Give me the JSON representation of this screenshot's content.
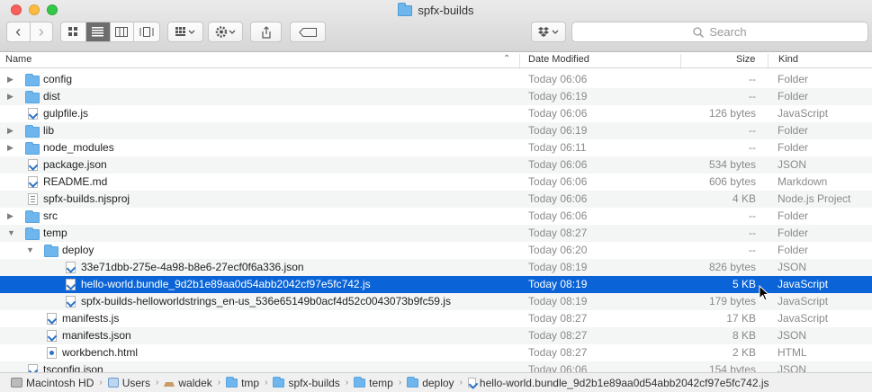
{
  "window": {
    "title": "spfx-builds"
  },
  "toolbar": {
    "back_glyph": "‹",
    "forward_glyph": "›",
    "search_placeholder": "Search",
    "icons": [
      "icon-view-icon",
      "list-view-icon",
      "column-view-icon",
      "gallery-view-icon",
      "group-icon",
      "gear-icon",
      "share-icon",
      "tag-icon",
      "dropbox-icon"
    ]
  },
  "columns": {
    "name": "Name",
    "date": "Date Modified",
    "size": "Size",
    "kind": "Kind",
    "sort_glyph": "⌃"
  },
  "rows": [
    {
      "name": "config",
      "date": "Today 06:06",
      "size": "--",
      "kind": "Folder"
    },
    {
      "name": "dist",
      "date": "Today 06:19",
      "size": "--",
      "kind": "Folder"
    },
    {
      "name": "gulpfile.js",
      "date": "Today 06:06",
      "size": "126 bytes",
      "kind": "JavaScript"
    },
    {
      "name": "lib",
      "date": "Today 06:19",
      "size": "--",
      "kind": "Folder"
    },
    {
      "name": "node_modules",
      "date": "Today 06:11",
      "size": "--",
      "kind": "Folder"
    },
    {
      "name": "package.json",
      "date": "Today 06:06",
      "size": "534 bytes",
      "kind": "JSON"
    },
    {
      "name": "README.md",
      "date": "Today 06:06",
      "size": "606 bytes",
      "kind": "Markdown"
    },
    {
      "name": "spfx-builds.njsproj",
      "date": "Today 06:06",
      "size": "4 KB",
      "kind": "Node.js Project"
    },
    {
      "name": "src",
      "date": "Today 06:06",
      "size": "--",
      "kind": "Folder"
    },
    {
      "name": "temp",
      "date": "Today 08:27",
      "size": "--",
      "kind": "Folder"
    },
    {
      "name": "deploy",
      "date": "Today 06:20",
      "size": "--",
      "kind": "Folder"
    },
    {
      "name": "33e71dbb-275e-4a98-b8e6-27ecf0f6a336.json",
      "date": "Today 08:19",
      "size": "826 bytes",
      "kind": "JSON"
    },
    {
      "name": "hello-world.bundle_9d2b1e89aa0d54abb2042cf97e5fc742.js",
      "date": "Today 08:19",
      "size": "5 KB",
      "kind": "JavaScript"
    },
    {
      "name": "spfx-builds-helloworldstrings_en-us_536e65149b0acf4d52c0043073b9fc59.js",
      "date": "Today 08:19",
      "size": "179 bytes",
      "kind": "JavaScript"
    },
    {
      "name": "manifests.js",
      "date": "Today 08:27",
      "size": "17 KB",
      "kind": "JavaScript"
    },
    {
      "name": "manifests.json",
      "date": "Today 08:27",
      "size": "8 KB",
      "kind": "JSON"
    },
    {
      "name": "workbench.html",
      "date": "Today 08:27",
      "size": "2 KB",
      "kind": "HTML"
    },
    {
      "name": "tsconfig.json",
      "date": "Today 06:06",
      "size": "154 bytes",
      "kind": "JSON"
    }
  ],
  "row_meta": [
    {
      "indent": 0,
      "type": "folder",
      "expander": "▶"
    },
    {
      "indent": 0,
      "type": "folder",
      "expander": "▶"
    },
    {
      "indent": 0,
      "type": "js",
      "expander": ""
    },
    {
      "indent": 0,
      "type": "folder",
      "expander": "▶"
    },
    {
      "indent": 0,
      "type": "folder",
      "expander": "▶"
    },
    {
      "indent": 0,
      "type": "js",
      "expander": ""
    },
    {
      "indent": 0,
      "type": "js",
      "expander": ""
    },
    {
      "indent": 0,
      "type": "proj",
      "expander": ""
    },
    {
      "indent": 0,
      "type": "folder",
      "expander": "▶"
    },
    {
      "indent": 0,
      "type": "folder",
      "expander": "▼"
    },
    {
      "indent": 1,
      "type": "folder",
      "expander": "▼"
    },
    {
      "indent": 2,
      "type": "js",
      "expander": ""
    },
    {
      "indent": 2,
      "type": "js",
      "expander": "",
      "selected": true
    },
    {
      "indent": 2,
      "type": "js",
      "expander": ""
    },
    {
      "indent": 1,
      "type": "js",
      "expander": ""
    },
    {
      "indent": 1,
      "type": "js",
      "expander": ""
    },
    {
      "indent": 1,
      "type": "html",
      "expander": ""
    },
    {
      "indent": 0,
      "type": "js",
      "expander": ""
    }
  ],
  "path_bar": [
    "Macintosh HD",
    "Users",
    "waldek",
    "tmp",
    "spfx-builds",
    "temp",
    "deploy",
    "hello-world.bundle_9d2b1e89aa0d54abb2042cf97e5fc742.js"
  ],
  "colors": {
    "selection": "#0a64d7",
    "folder": "#6fb6ec"
  }
}
